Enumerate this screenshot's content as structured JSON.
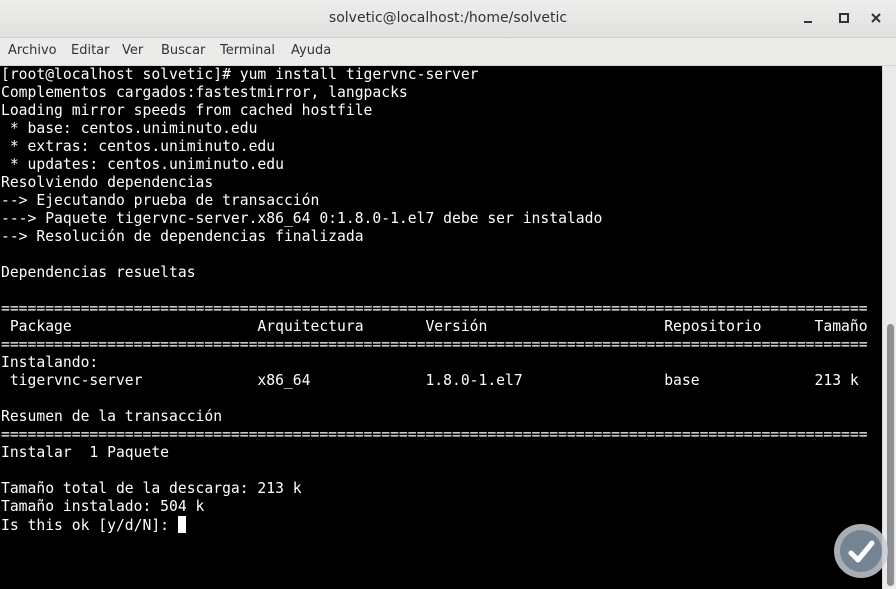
{
  "window": {
    "title": "solvetic@localhost:/home/solvetic",
    "minimize_icon": "minimize-icon",
    "maximize_icon": "maximize-icon",
    "close_icon": "close-icon"
  },
  "menubar": {
    "items": [
      {
        "label": "Archivo"
      },
      {
        "label": "Editar"
      },
      {
        "label": "Ver"
      },
      {
        "label": "Buscar"
      },
      {
        "label": "Terminal"
      },
      {
        "label": "Ayuda"
      }
    ]
  },
  "terminal": {
    "lines": [
      "[root@localhost solvetic]# yum install tigervnc-server",
      "Complementos cargados:fastestmirror, langpacks",
      "Loading mirror speeds from cached hostfile",
      " * base: centos.uniminuto.edu",
      " * extras: centos.uniminuto.edu",
      " * updates: centos.uniminuto.edu",
      "Resolviendo dependencias",
      "--> Ejecutando prueba de transacción",
      "---> Paquete tigervnc-server.x86_64 0:1.8.0-1.el7 debe ser instalado",
      "--> Resolución de dependencias finalizada",
      "",
      "Dependencias resueltas",
      "",
      "==================================================================================================",
      " Package                     Arquitectura       Versión                    Repositorio      Tamaño",
      "==================================================================================================",
      "Instalando:",
      " tigervnc-server             x86_64             1.8.0-1.el7                base             213 k",
      "",
      "Resumen de la transacción",
      "==================================================================================================",
      "Instalar  1 Paquete",
      "",
      "Tamaño total de la descarga: 213 k",
      "Tamaño instalado: 504 k",
      "Is this ok [y/d/N]: "
    ]
  },
  "watermark": {
    "icon": "solvetic-logo-icon",
    "colors": {
      "outer": "#c7cdd3",
      "inner": "#6f7f8f"
    }
  }
}
